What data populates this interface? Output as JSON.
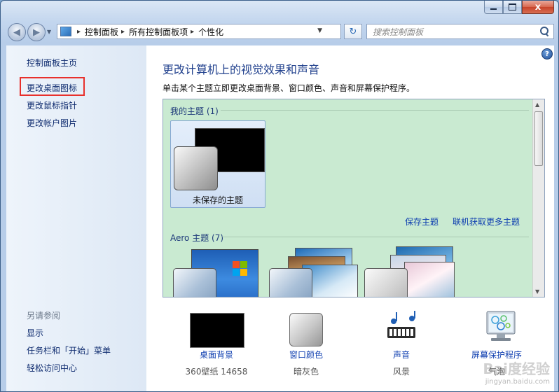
{
  "window": {
    "minimize_glyph": "—",
    "close_glyph": "x"
  },
  "nav": {
    "back_glyph": "◀",
    "forward_glyph": "▶",
    "breadcrumb": [
      "控制面板",
      "所有控制面板项",
      "个性化"
    ],
    "search_placeholder": "搜索控制面板",
    "refresh_glyph": "↻"
  },
  "sidebar": {
    "home": "控制面板主页",
    "links": [
      "更改桌面图标",
      "更改鼠标指针",
      "更改帐户图片"
    ],
    "see_also_title": "另请参阅",
    "see_also": [
      "显示",
      "任务栏和「开始」菜单",
      "轻松访问中心"
    ]
  },
  "main": {
    "help_glyph": "?",
    "title": "更改计算机上的视觉效果和声音",
    "description": "单击某个主题立即更改桌面背景、窗口颜色、声音和屏幕保护程序。",
    "my_themes_label": "我的主题 (1)",
    "unsaved_theme_label": "未保存的主题",
    "save_theme_link": "保存主题",
    "get_more_link": "联机获取更多主题",
    "aero_label": "Aero 主题 (7)"
  },
  "bottom": {
    "items": [
      {
        "label": "桌面背景",
        "sub": "360壁纸 14658"
      },
      {
        "label": "窗口颜色",
        "sub": "暗灰色"
      },
      {
        "label": "声音",
        "sub": "风景"
      },
      {
        "label": "屏幕保护程序",
        "sub": "气泡"
      }
    ]
  },
  "watermark": {
    "text": "Bai度经验",
    "url": "jingyan.baidu.com"
  },
  "colors": {
    "accent_link": "#0f3fb0",
    "title_blue": "#1f3f8c",
    "highlight_red": "#e8302c",
    "theme_bg": "#c9ead1"
  }
}
